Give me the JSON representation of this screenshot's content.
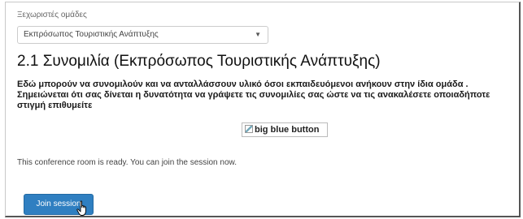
{
  "groups": {
    "label": "Ξεχωριστές ομάδες",
    "selected": "Εκπρόσωπος Τουριστικής Ανάπτυξης"
  },
  "page": {
    "title": "2.1 Συνομιλία (Εκπρόσωπος Τουριστικής Ανάπτυξης)",
    "description_line1": "Εδώ μπορούν να συνομιλούν και να ανταλλάσσουν υλικό όσοι εκπαιδευόμενοι  ανήκουν στην ίδια ομάδα .",
    "description_line2": "Σημειώνεται ότι σας δίνεται η δυνατότητα να γράψετε τις συνομιλίες σας ώστε να τις ανακαλέσετε οποιαδήποτε",
    "description_line3": "στιγμή επιθυμείτε",
    "image_alt": "big blue button"
  },
  "conference": {
    "status": "This conference room is ready. You can join the session now.",
    "join_label": "Join session"
  },
  "colors": {
    "button": "#2f7fc1"
  },
  "icons": {
    "dropdown": "caret-down-icon",
    "image": "broken-image-icon",
    "pointer": "hand-pointer-icon"
  }
}
